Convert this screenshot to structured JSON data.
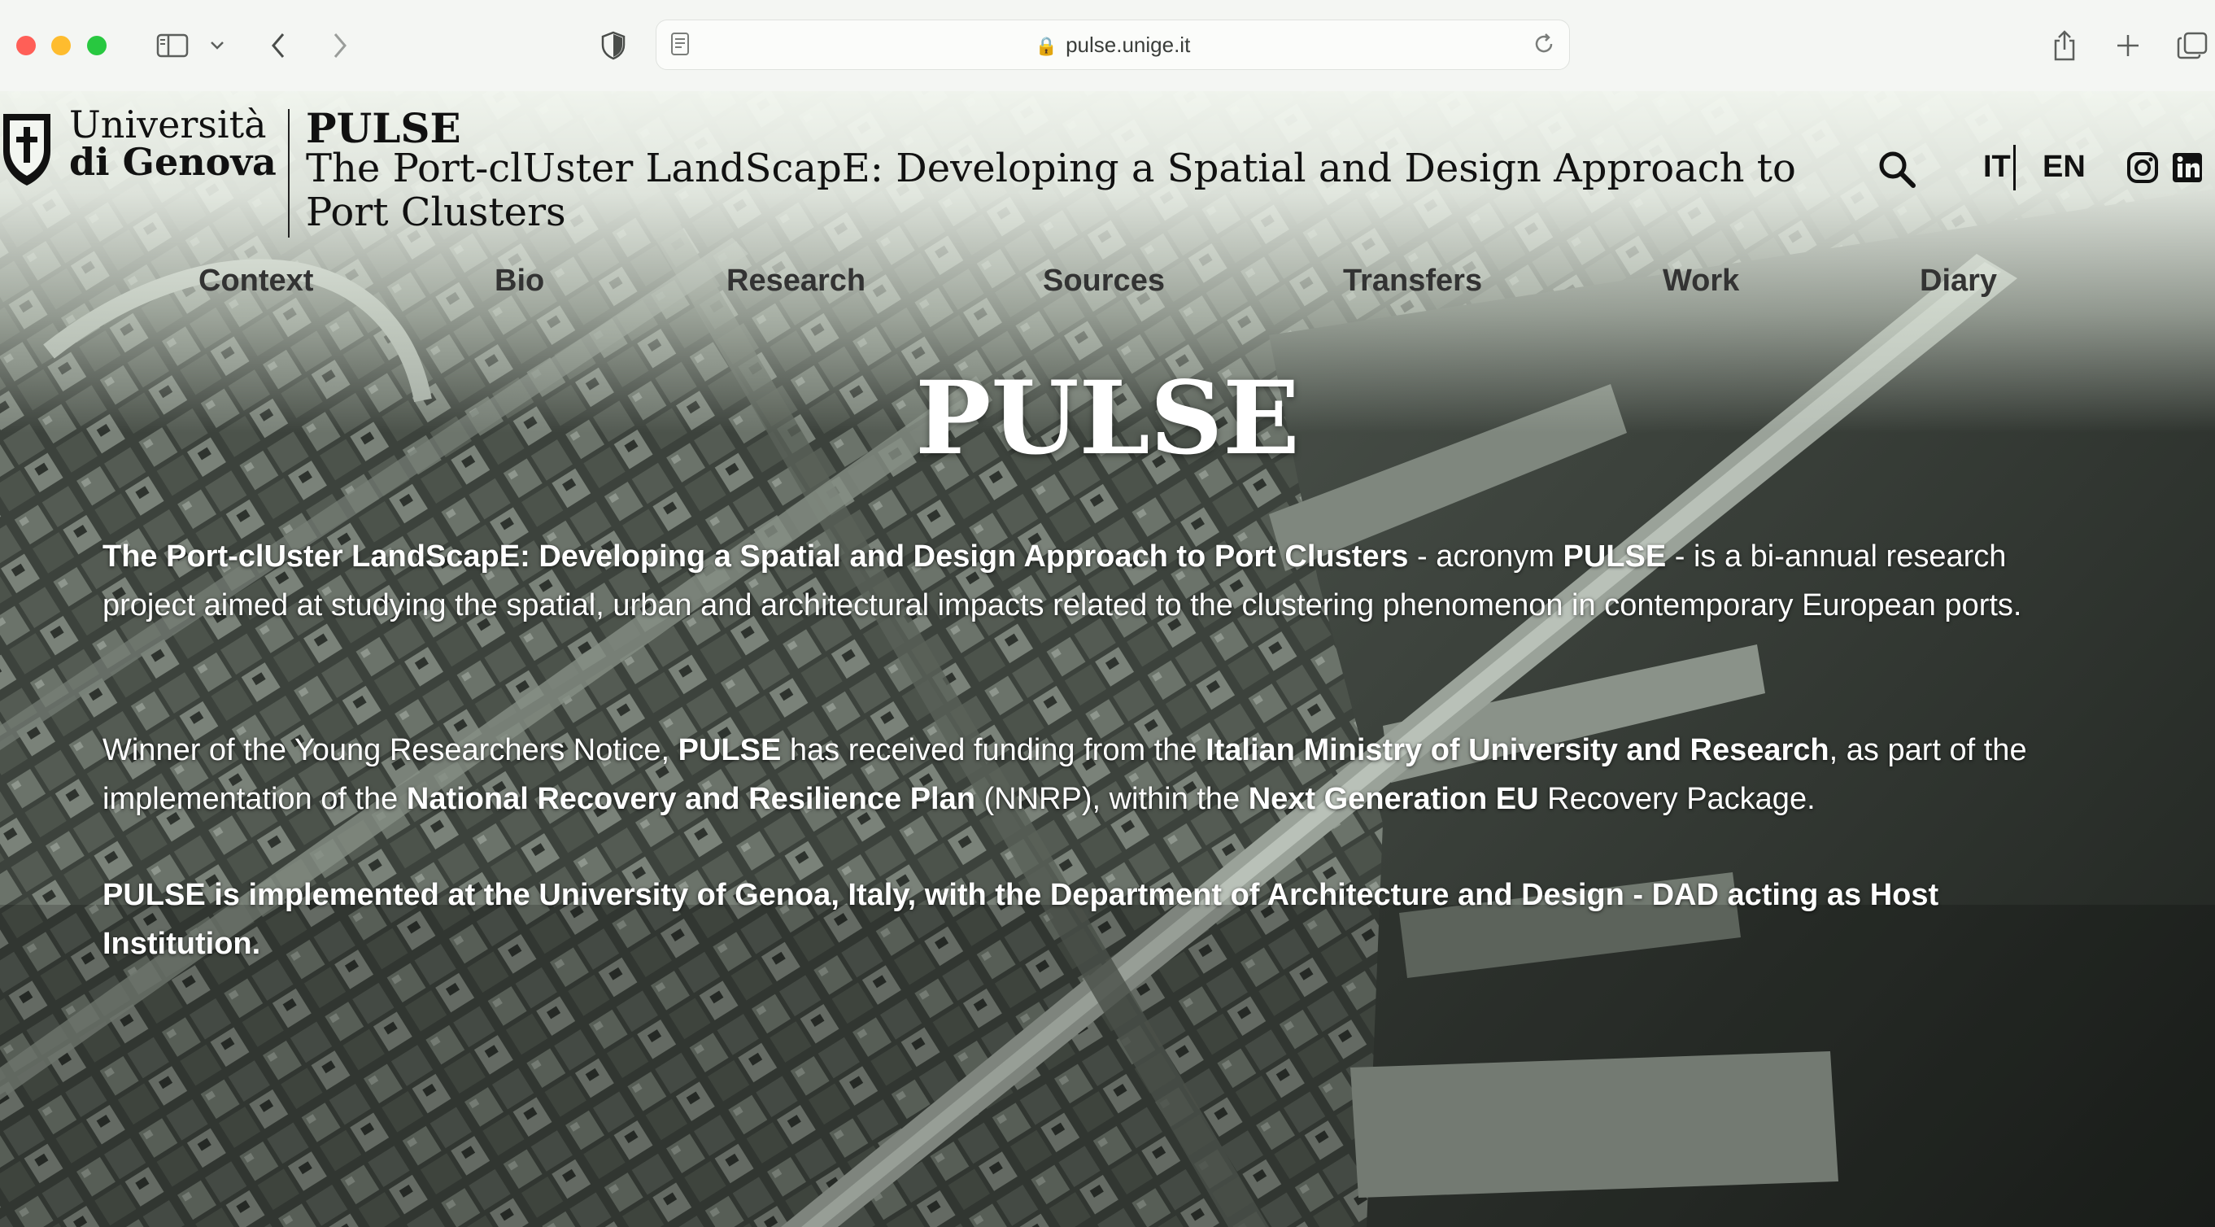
{
  "browser": {
    "url": "pulse.unige.it",
    "icons": [
      "sidebar-icon",
      "chevron-down-icon",
      "back-icon",
      "forward-icon",
      "privacy-shield-icon",
      "reader-icon",
      "lock-icon",
      "reload-icon",
      "share-icon",
      "new-tab-icon",
      "tab-overview-icon"
    ]
  },
  "header": {
    "university_line1": "Università",
    "university_line2": "di Genova",
    "project_acronym": "PULSE",
    "project_full_title": "The Port-clUster LandScapE: Developing a Spatial and Design Approach to Port Clusters",
    "lang_it": "IT",
    "lang_en": "EN",
    "icons": [
      "search-icon",
      "instagram-icon",
      "linkedin-icon"
    ]
  },
  "nav": {
    "items": [
      "Context",
      "Bio",
      "Research",
      "Sources",
      "Transfers",
      "Work",
      "Diary"
    ]
  },
  "hero": {
    "title": "PULSE"
  },
  "content": {
    "p1": [
      {
        "t": "The Port-clUster LandScapE: Developing a Spatial and Design Approach to Port Clusters",
        "b": true
      },
      {
        "t": " - acronym ",
        "b": false
      },
      {
        "t": "PULSE",
        "b": true
      },
      {
        "t": " - is a bi-annual research project aimed at studying the spatial, urban and architectural impacts related to the clustering phenomenon in contemporary European ports.",
        "b": false
      }
    ],
    "p2": [
      {
        "t": "Winner of the Young Researchers Notice,  ",
        "b": false
      },
      {
        "t": "PULSE",
        "b": true
      },
      {
        "t": " has received funding from the ",
        "b": false
      },
      {
        "t": "Italian Ministry of University and Research",
        "b": true
      },
      {
        "t": ", as part of the implementation of the ",
        "b": false
      },
      {
        "t": "National Recovery and Resilience Plan",
        "b": true
      },
      {
        "t": " (NNRP), within the ",
        "b": false
      },
      {
        "t": "Next Generation EU",
        "b": true
      },
      {
        "t": " Recovery Package.",
        "b": false
      }
    ],
    "p3": [
      {
        "t": "PULSE is implemented at the University of Genoa, Italy, with the Department of Architecture and Design - DAD acting as Host Institution.",
        "b": true
      }
    ]
  }
}
